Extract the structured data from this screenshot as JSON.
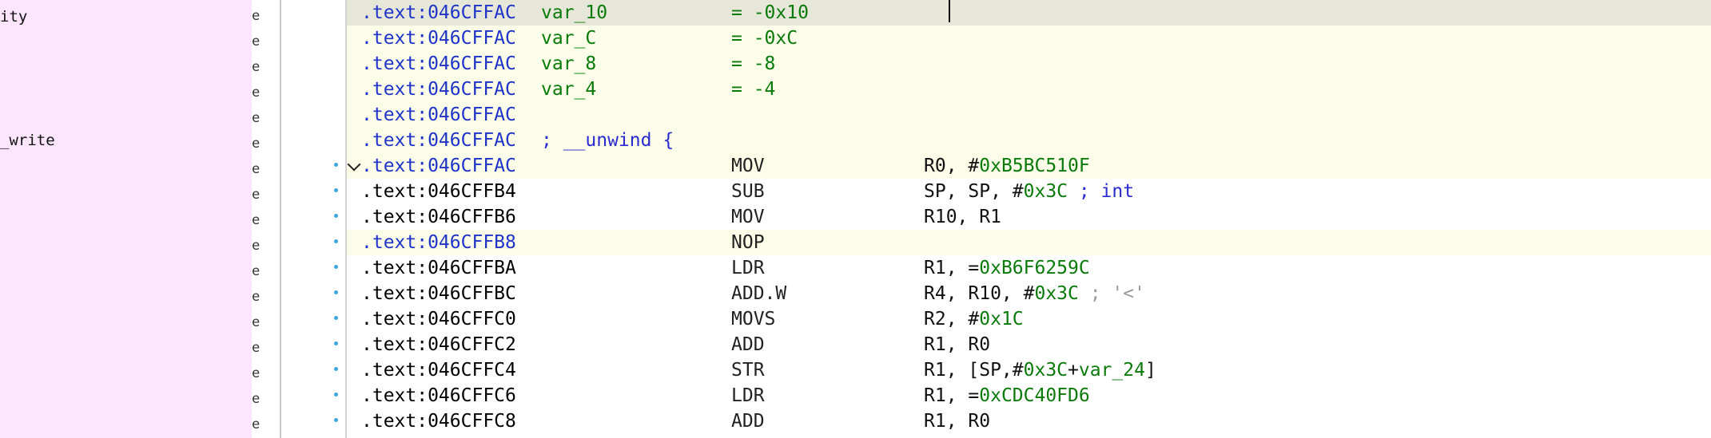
{
  "left_panel": {
    "items": [
      {
        "label": "ity"
      },
      {
        "label": "_write"
      }
    ],
    "strip_glyph": "e"
  },
  "listing": {
    "rows": [
      {
        "address": ".text:046CFFAC",
        "var": "var_10",
        "value": "= -0x10"
      },
      {
        "address": ".text:046CFFAC",
        "var": "var_C",
        "value": "= -0xC"
      },
      {
        "address": ".text:046CFFAC",
        "var": "var_8",
        "value": "= -8"
      },
      {
        "address": ".text:046CFFAC",
        "var": "var_4",
        "value": "= -4"
      },
      {
        "address": ".text:046CFFAC"
      },
      {
        "address": ".text:046CFFAC",
        "comment": "; __unwind {"
      },
      {
        "address": ".text:046CFFAC",
        "mnemonic": "MOV",
        "operands_plain": "R0, #",
        "operands_green": "0xB5BC510F"
      },
      {
        "address": ".text:046CFFB4",
        "mnemonic": "SUB",
        "operands_plain": "SP, SP, #",
        "operands_green": "0x3C",
        "comment": " ; int"
      },
      {
        "address": ".text:046CFFB6",
        "mnemonic": "MOV",
        "operands_plain": "R10, R1"
      },
      {
        "address": ".text:046CFFB8",
        "mnemonic": "NOP"
      },
      {
        "address": ".text:046CFFBA",
        "mnemonic": "LDR",
        "operands_plain": "R1, =",
        "operands_green": "0xB6F6259C"
      },
      {
        "address": ".text:046CFFBC",
        "mnemonic": "ADD.W",
        "operands_plain": "R4, R10, #",
        "operands_green": "0x3C",
        "comment_gray": " ; '<'"
      },
      {
        "address": ".text:046CFFC0",
        "mnemonic": "MOVS",
        "operands_plain": "R2, #",
        "operands_green": "0x1C"
      },
      {
        "address": ".text:046CFFC2",
        "mnemonic": "ADD",
        "operands_plain": "R1, R0"
      },
      {
        "address": ".text:046CFFC4",
        "mnemonic": "STR",
        "operands_plain": "R1, [SP,#",
        "operands_green": "0x3C",
        "operands_plain2": "+",
        "operands_green2": "var_24",
        "operands_plain3": "]"
      },
      {
        "address": ".text:046CFFC6",
        "mnemonic": "LDR",
        "operands_plain": "R1, =",
        "operands_green": "0xCDC40FD6"
      },
      {
        "address": ".text:046CFFC8",
        "mnemonic": "ADD",
        "operands_plain": "R1, R0"
      }
    ]
  }
}
